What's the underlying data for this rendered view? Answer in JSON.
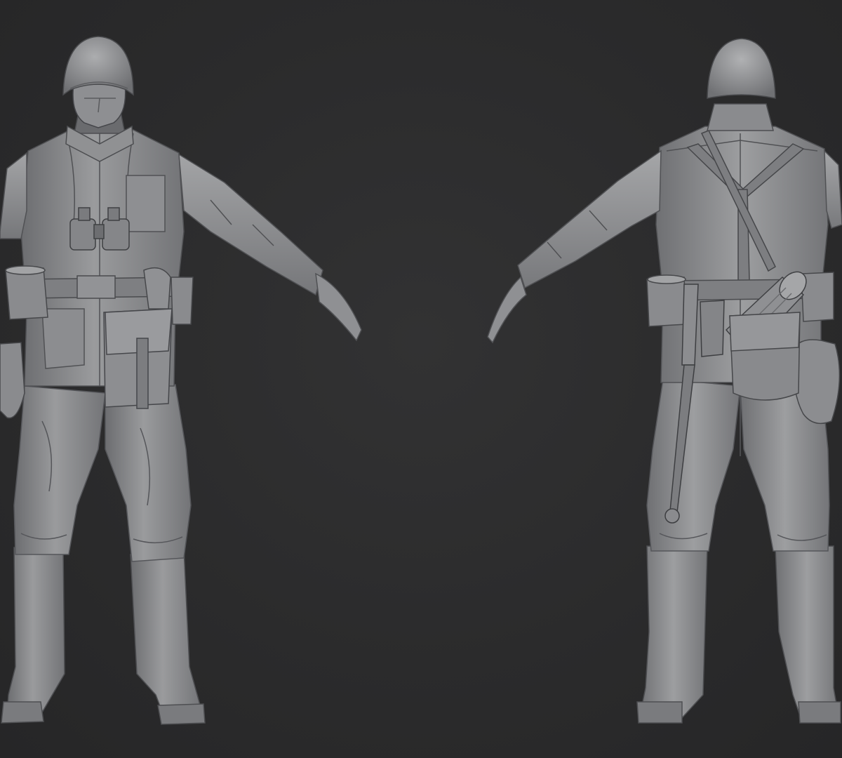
{
  "scene": {
    "background_color": "#2b2b2c",
    "model_color": "#8a8b8d",
    "model_shadow_color": "#5c5d60",
    "model_highlight_color": "#b4b5b7",
    "views": [
      {
        "name": "front",
        "icon": "soldier-front-render"
      },
      {
        "name": "back",
        "icon": "soldier-back-render"
      }
    ]
  }
}
